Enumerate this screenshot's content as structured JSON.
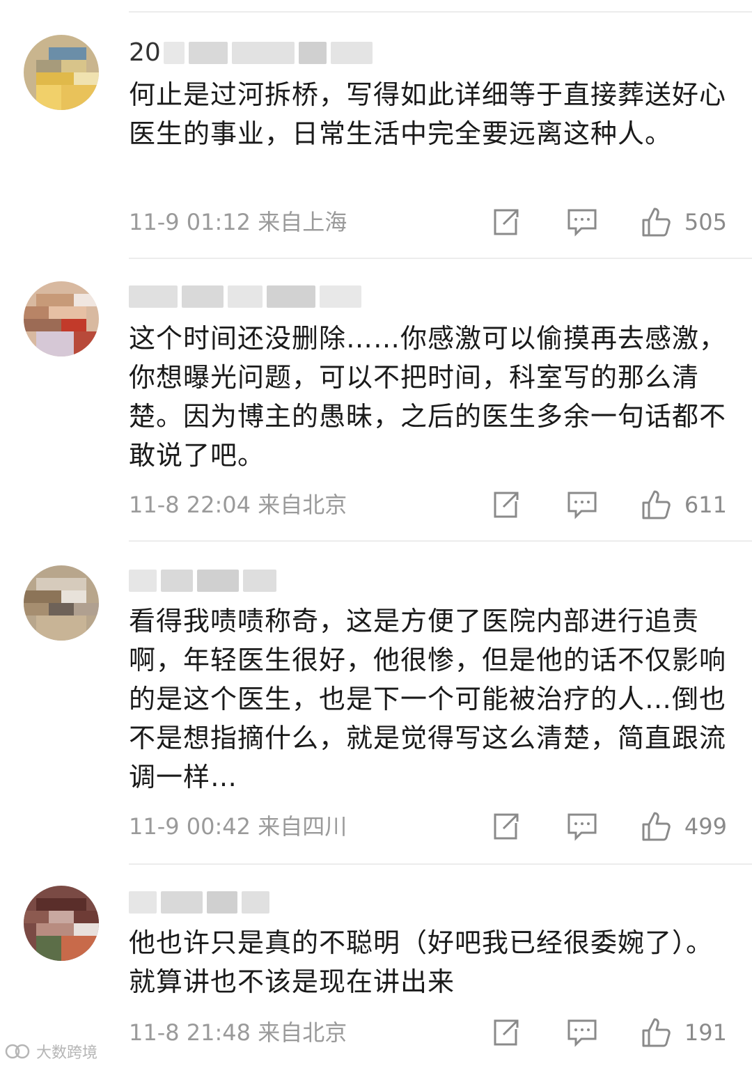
{
  "comments": [
    {
      "username": "20",
      "text": "何止是过河拆桥，写得如此详细等于直接葬送好心医生的事业，日常生活中完全要远离这种人。",
      "time": "11-9 01:12 来自上海",
      "likes": "505"
    },
    {
      "username": "",
      "text": "这个时间还没删除……你感激可以偷摸再去感激，你想曝光问题，可以不把时间，科室写的那么清楚。因为博主的愚昧，之后的医生多余一句话都不敢说了吧。",
      "time": "11-8 22:04 来自北京",
      "likes": "611"
    },
    {
      "username": "",
      "text": "看得我啧啧称奇，这是方便了医院内部进行追责啊，年轻医生很好，他很惨，但是他的话不仅影响的是这个医生，也是下一个可能被治疗的人…倒也不是想指摘什么，就是觉得写这么清楚，简直跟流调一样…",
      "time": "11-9 00:42 来自四川",
      "likes": "499"
    },
    {
      "username": "",
      "text": "他也许只是真的不聪明（好吧我已经很委婉了）。就算讲也不该是现在讲出来",
      "time": "11-8 21:48 来自北京",
      "likes": "191"
    }
  ],
  "icons": {
    "share": "share-icon",
    "reply": "comment-icon",
    "like": "thumbs-up-icon"
  },
  "watermark": "大数跨境"
}
